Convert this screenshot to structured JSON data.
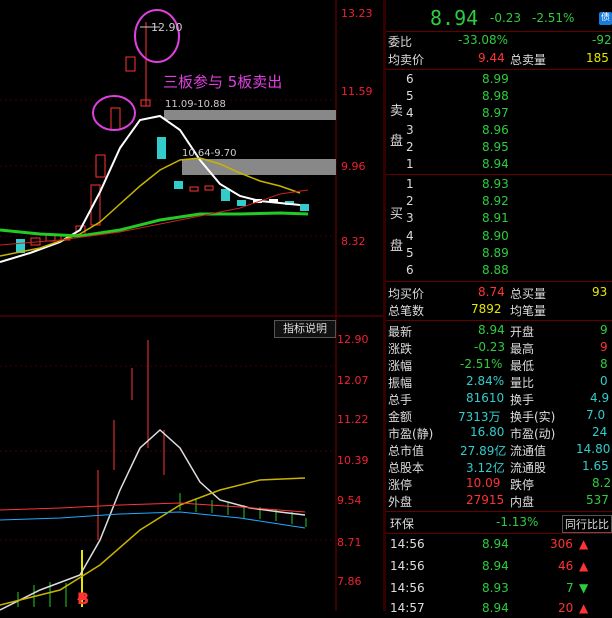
{
  "stock": {
    "price": "8.94",
    "change": "-0.23",
    "change_pct": "-2.51%",
    "badge": "债"
  },
  "kline_axis": [
    "13.23",
    "11.59",
    "9.96",
    "8.32"
  ],
  "indicator_axis": [
    "12.90",
    "12.07",
    "11.22",
    "10.39",
    "9.54",
    "8.71",
    "7.86"
  ],
  "annotations": {
    "high_price": "12.90",
    "zone1": "11.09-10.88",
    "zone2": "10.64-9.70",
    "note": "三板参与  5板卖出",
    "signal": "B"
  },
  "indicator_button": "指标说明",
  "summary": {
    "weibi_label": "委比",
    "weibi_value": "-33.08%",
    "weibi_extra": "-92",
    "avg_sell_label": "均卖价",
    "avg_sell_value": "9.44",
    "total_sell_label": "总卖量",
    "total_sell_value": "185"
  },
  "sell_side_label": [
    "卖",
    "盘"
  ],
  "sell_orders": [
    {
      "level": "6",
      "price": "8.99"
    },
    {
      "level": "5",
      "price": "8.98"
    },
    {
      "level": "4",
      "price": "8.97"
    },
    {
      "level": "3",
      "price": "8.96"
    },
    {
      "level": "2",
      "price": "8.95"
    },
    {
      "level": "1",
      "price": "8.94"
    }
  ],
  "buy_side_label": [
    "买",
    "盘"
  ],
  "buy_orders": [
    {
      "level": "1",
      "price": "8.93"
    },
    {
      "level": "2",
      "price": "8.92"
    },
    {
      "level": "3",
      "price": "8.91"
    },
    {
      "level": "4",
      "price": "8.90"
    },
    {
      "level": "5",
      "price": "8.89"
    },
    {
      "level": "6",
      "price": "8.88"
    }
  ],
  "buy_summary": {
    "avg_buy_label": "均买价",
    "avg_buy_value": "8.74",
    "total_buy_label": "总买量",
    "total_buy_value": "93",
    "total_count_label": "总笔数",
    "total_count_value": "7892",
    "avg_vol_label": "均笔量"
  },
  "stats": [
    {
      "l1": "最新",
      "v1": "8.94",
      "c1": "green",
      "l2": "开盘",
      "v2": "9"
    },
    {
      "l1": "涨跌",
      "v1": "-0.23",
      "c1": "green",
      "l2": "最高",
      "v2": "9"
    },
    {
      "l1": "涨幅",
      "v1": "-2.51%",
      "c1": "green",
      "l2": "最低",
      "v2": "8"
    },
    {
      "l1": "振幅",
      "v1": "2.84%",
      "c1": "cyan",
      "l2": "量比",
      "v2": "0"
    },
    {
      "l1": "总手",
      "v1": "81610",
      "c1": "cyan",
      "l2": "换手",
      "v2": "4.9"
    },
    {
      "l1": "金额",
      "v1": "7313万",
      "c1": "cyan",
      "l2": "换手(实)",
      "v2": "7.0"
    },
    {
      "l1": "市盈(静)",
      "v1": "16.80",
      "c1": "cyan",
      "l2": "市盈(动)",
      "v2": "24"
    },
    {
      "l1": "总市值",
      "v1": "27.89亿",
      "c1": "cyan",
      "l2": "流通值",
      "v2": "14.80"
    },
    {
      "l1": "总股本",
      "v1": "3.12亿",
      "c1": "cyan",
      "l2": "流通股",
      "v2": "1.65"
    },
    {
      "l1": "涨停",
      "v1": "10.09",
      "c1": "red",
      "l2": "跌停",
      "v2": "8.2"
    },
    {
      "l1": "外盘",
      "v1": "27915",
      "c1": "red",
      "l2": "内盘",
      "v2": "537"
    }
  ],
  "sector": {
    "name": "环保",
    "pct": "-1.13%",
    "button": "同行比比"
  },
  "ticks": [
    {
      "time": "14:56",
      "price": "8.94",
      "vol": "306",
      "dir": "up"
    },
    {
      "time": "14:56",
      "price": "8.94",
      "vol": "46",
      "dir": "up"
    },
    {
      "time": "14:56",
      "price": "8.93",
      "vol": "7",
      "dir": "down"
    },
    {
      "time": "14:57",
      "price": "8.94",
      "vol": "20",
      "dir": "up"
    }
  ]
}
